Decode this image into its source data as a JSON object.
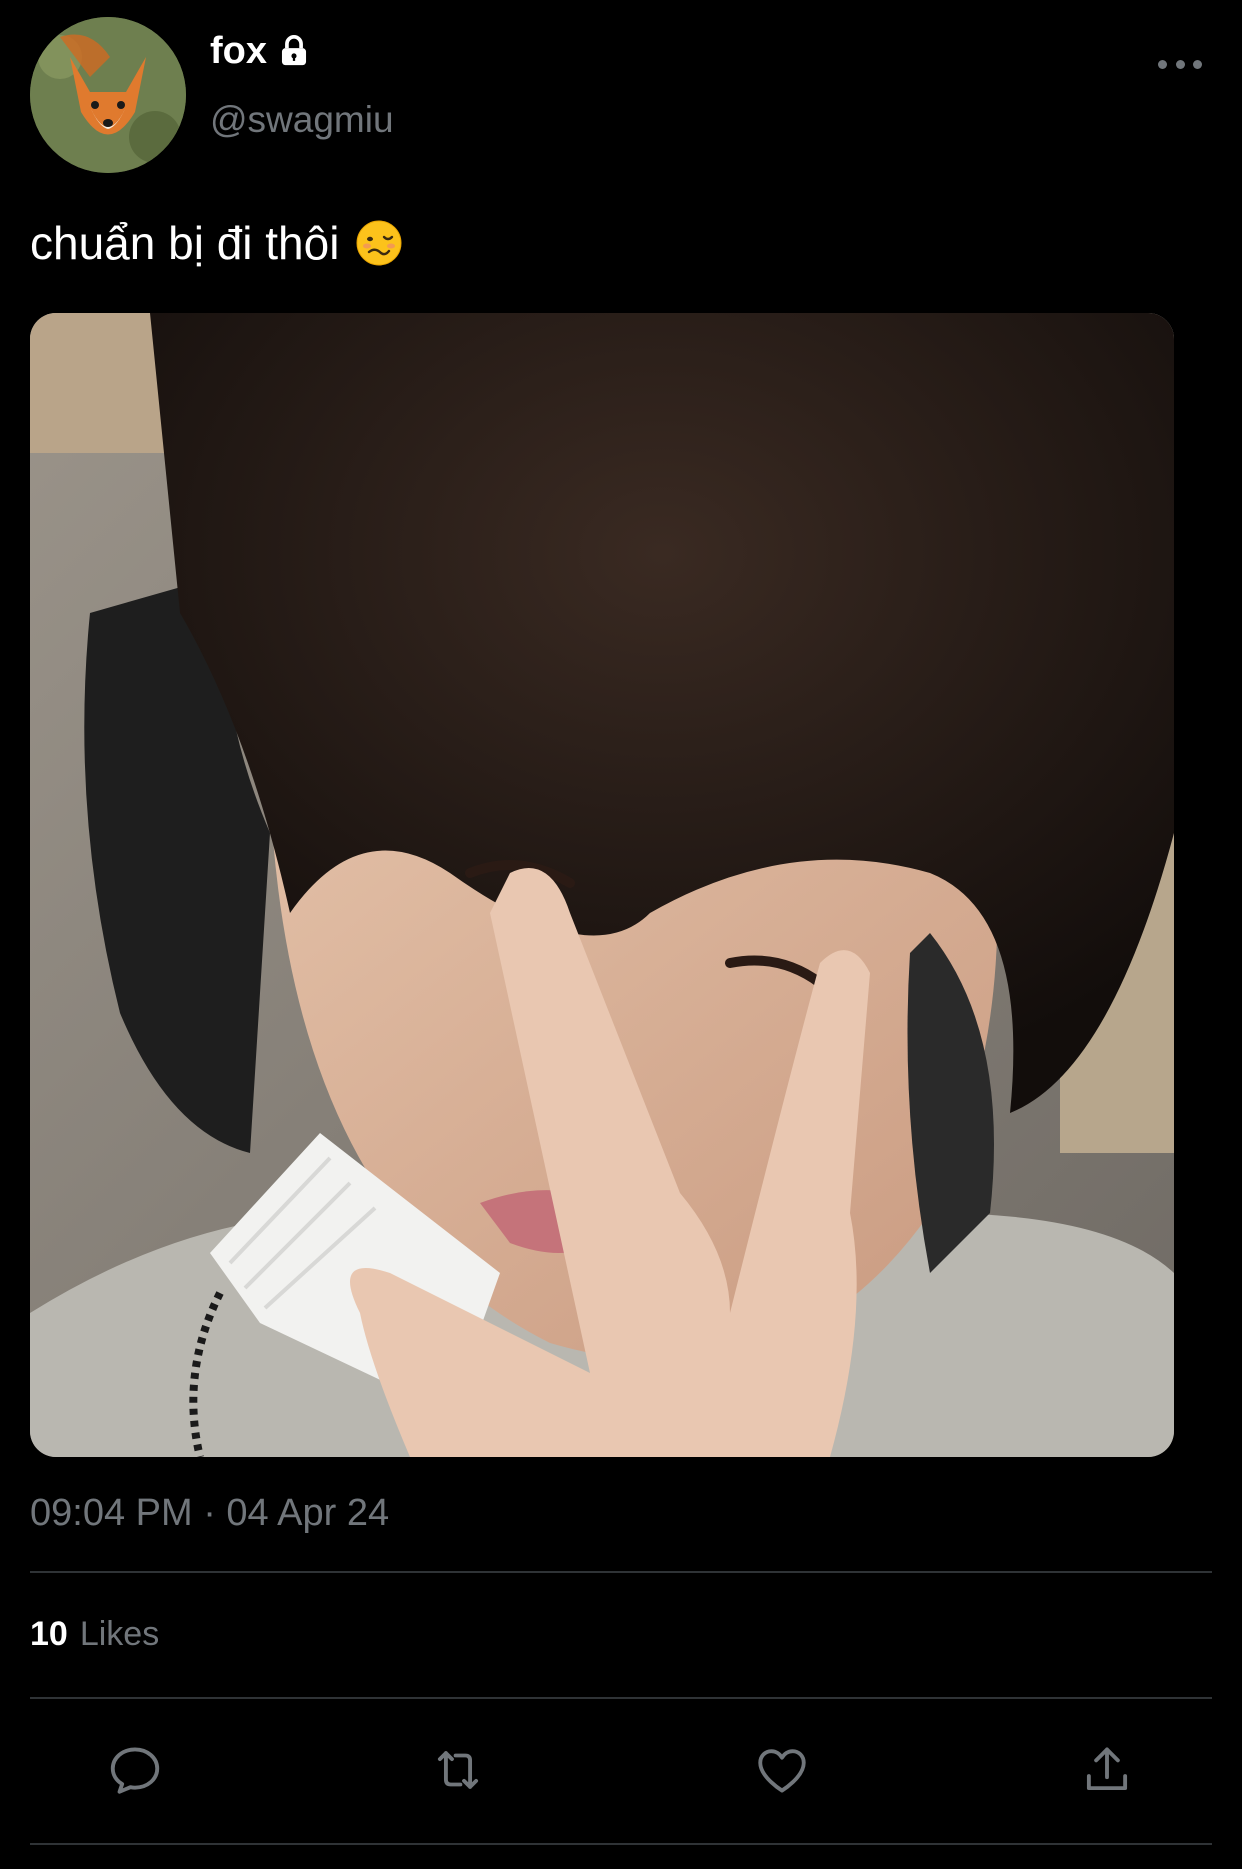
{
  "author": {
    "display_name": "fox",
    "handle": "@swagmiu",
    "protected": true,
    "avatar_icon": "fox-avatar-icon"
  },
  "tweet": {
    "text": "chuẩn bị đi thôi",
    "emoji": "woozy-face-emoji",
    "media_alt": "selfie-photo",
    "timestamp": "09:04 PM · 04 Apr 24"
  },
  "stats": {
    "likes_count": "10",
    "likes_label": "Likes"
  },
  "actions": {
    "reply_icon": "reply-icon",
    "retweet_icon": "retweet-icon",
    "like_icon": "heart-icon",
    "share_icon": "share-icon"
  },
  "colors": {
    "background": "#000000",
    "text_primary": "#ffffff",
    "text_secondary": "#71767b",
    "divider": "#2f3336"
  }
}
